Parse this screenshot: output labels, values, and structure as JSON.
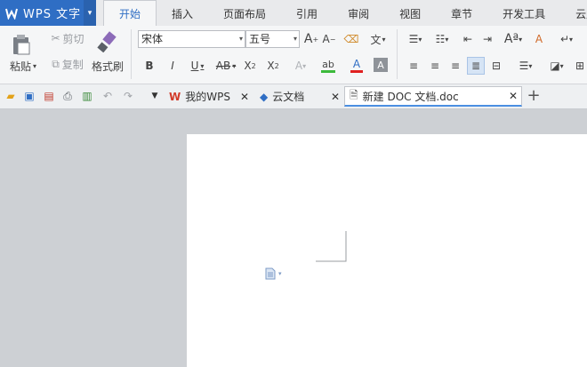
{
  "app": {
    "title": "WPS 文字"
  },
  "menu": {
    "tabs": [
      "开始",
      "插入",
      "页面布局",
      "引用",
      "审阅",
      "视图",
      "章节",
      "开发工具",
      "云服"
    ],
    "active_index": 0
  },
  "ribbon": {
    "paste_label": "粘贴",
    "cut_label": "剪切",
    "copy_label": "复制",
    "format_painter_label": "格式刷",
    "font_name": "宋体",
    "font_size": "五号",
    "glyphs": {
      "grow": "A",
      "shrink": "A",
      "pinyin": "文",
      "bold": "B",
      "italic": "I",
      "underline": "U",
      "strike": "AB",
      "sup": "X",
      "sub": "X",
      "effect": "A",
      "highlight": "ab",
      "color": "A",
      "shade": "A",
      "sort": "A"
    }
  },
  "doc_tabs": [
    {
      "label": "我的WPS",
      "icon": "wps-icon"
    },
    {
      "label": "云文档",
      "icon": "cloud-cube-icon"
    },
    {
      "label": "新建 DOC 文档.doc",
      "icon": "document-icon",
      "active": true
    }
  ],
  "colors": {
    "brand": "#2f6ec4",
    "active_tab_underline": "#4b8fe2",
    "highlight_bar": "#3cba3c",
    "font_color_bar": "#e02020"
  }
}
